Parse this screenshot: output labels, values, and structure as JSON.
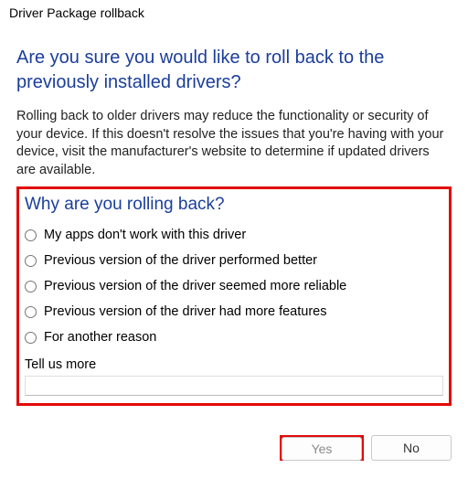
{
  "window": {
    "title": "Driver Package rollback"
  },
  "heading": "Are you sure you would like to roll back to the previously installed drivers?",
  "body": "Rolling back to older drivers may reduce the functionality or security of your device. If this doesn't resolve the issues that you're having with your device, visit the manufacturer's website to determine if updated drivers are available.",
  "sub_heading": "Why are you rolling back?",
  "reasons": {
    "r0": "My apps don't work with this driver",
    "r1": "Previous version of the driver performed better",
    "r2": "Previous version of the driver seemed more reliable",
    "r3": "Previous version of the driver had more features",
    "r4": "For another reason"
  },
  "tell_us_label": "Tell us more",
  "tell_us_value": "",
  "buttons": {
    "yes": "Yes",
    "no": "No"
  }
}
